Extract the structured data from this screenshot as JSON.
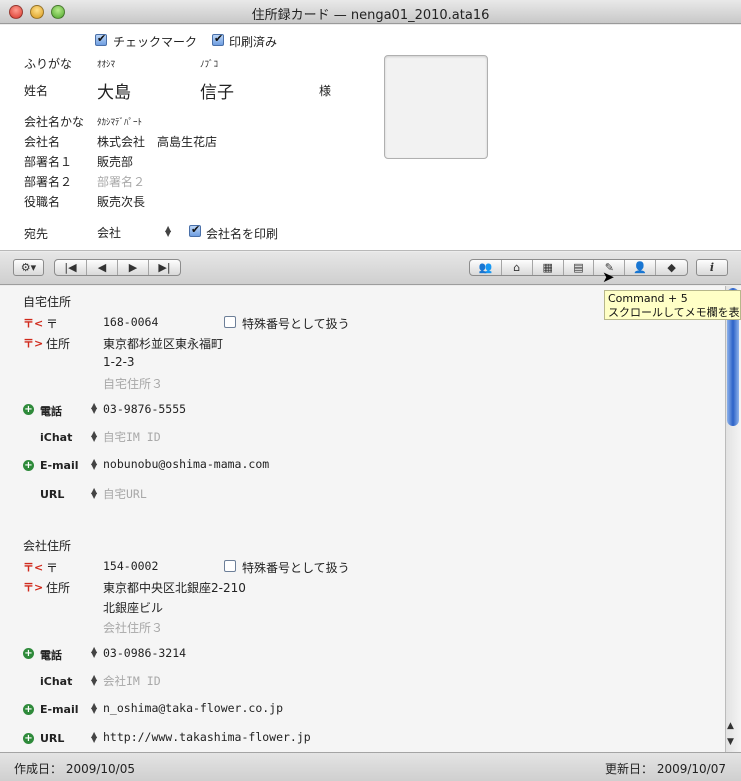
{
  "window": {
    "title": "住所録カード — nenga01_2010.ata16"
  },
  "checks": {
    "checkmark_label": "チェックマーク",
    "printed_label": "印刷済み"
  },
  "name": {
    "furigana_label": "ふりがな",
    "furigana_last": "ｵｵｼﾏ",
    "furigana_first": "ﾉﾌﾞｺ",
    "name_label": "姓名",
    "last_name": "大島",
    "first_name": "信子",
    "honorific": "様"
  },
  "company": {
    "kana_label": "会社名かな",
    "kana_value": "ﾀｶｼﾏﾃﾞﾊﾟｰﾄ",
    "name_label": "会社名",
    "name_value": "株式会社　高島生花店",
    "dept1_label": "部署名１",
    "dept1_value": "販売部",
    "dept2_label": "部署名２",
    "dept2_placeholder": "部署名２",
    "title_label": "役職名",
    "title_value": "販売次長"
  },
  "address_to": {
    "label": "宛先",
    "selected": "会社",
    "print_company_label": "会社名を印刷"
  },
  "toolbar": {
    "gear": "⚙▾",
    "info": "i"
  },
  "tooltip": {
    "line1": "Command + 5",
    "line2": "スクロールしてメモ欄を表示"
  },
  "home": {
    "section_label": "自宅住所",
    "postal_mark": "〒<",
    "postal_label": "〒",
    "postal_value": "168-0064",
    "special_label": "特殊番号として扱う",
    "address_mark": "〒>",
    "address_label": "住所",
    "address1": "東京都杉並区東永福町",
    "address2": "1-2-3",
    "address3_placeholder": "自宅住所３",
    "phone_label": "電話",
    "phone_value": "03-9876-5555",
    "ichat_label": "iChat",
    "ichat_placeholder": "自宅IM ID",
    "email_label": "E-mail",
    "email_value": "nobunobu@oshima-mama.com",
    "url_label": "URL",
    "url_placeholder": "自宅URL"
  },
  "work": {
    "section_label": "会社住所",
    "postal_mark": "〒<",
    "postal_label": "〒",
    "postal_value": "154-0002",
    "special_label": "特殊番号として扱う",
    "address_mark": "〒>",
    "address_label": "住所",
    "address1": "東京都中央区北銀座2-210",
    "address2": "北銀座ビル",
    "address3_placeholder": "会社住所３",
    "phone_label": "電話",
    "phone_value": "03-0986-3214",
    "ichat_label": "iChat",
    "ichat_placeholder": "会社IM ID",
    "email_label": "E-mail",
    "email_value": "n_oshima@taka-flower.co.jp",
    "url_label": "URL",
    "url_value": "http://www.takashima-flower.jp"
  },
  "status": {
    "created": "作成日： 2009/10/05",
    "updated": "更新日： 2009/10/07"
  },
  "colors": {
    "accent": "#2c62c8",
    "postal_red": "#d02a1c",
    "plus_green": "#2e8a3a"
  }
}
